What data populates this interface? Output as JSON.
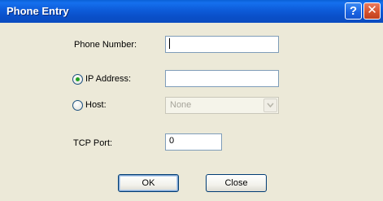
{
  "window": {
    "title": "Phone Entry",
    "help_glyph": "?",
    "close_glyph": "✕"
  },
  "form": {
    "phone_number": {
      "label": "Phone Number:",
      "value": ""
    },
    "ip_address": {
      "label": "IP Address:",
      "value": "",
      "selected": true
    },
    "host": {
      "label": "Host:",
      "selected_option": "None",
      "selected": false,
      "disabled": true
    },
    "tcp_port": {
      "label": "TCP Port:",
      "value": "0"
    }
  },
  "buttons": {
    "ok_label": "OK",
    "close_label": "Close"
  },
  "colors": {
    "title_bar": "#0a5fd6",
    "dialog_background": "#ece9d8",
    "radio_selected_dot": "#21a121",
    "input_border": "#7f9db9"
  },
  "icons": {
    "help": "help-icon",
    "close": "close-icon",
    "dropdown": "chevron-down-icon"
  }
}
